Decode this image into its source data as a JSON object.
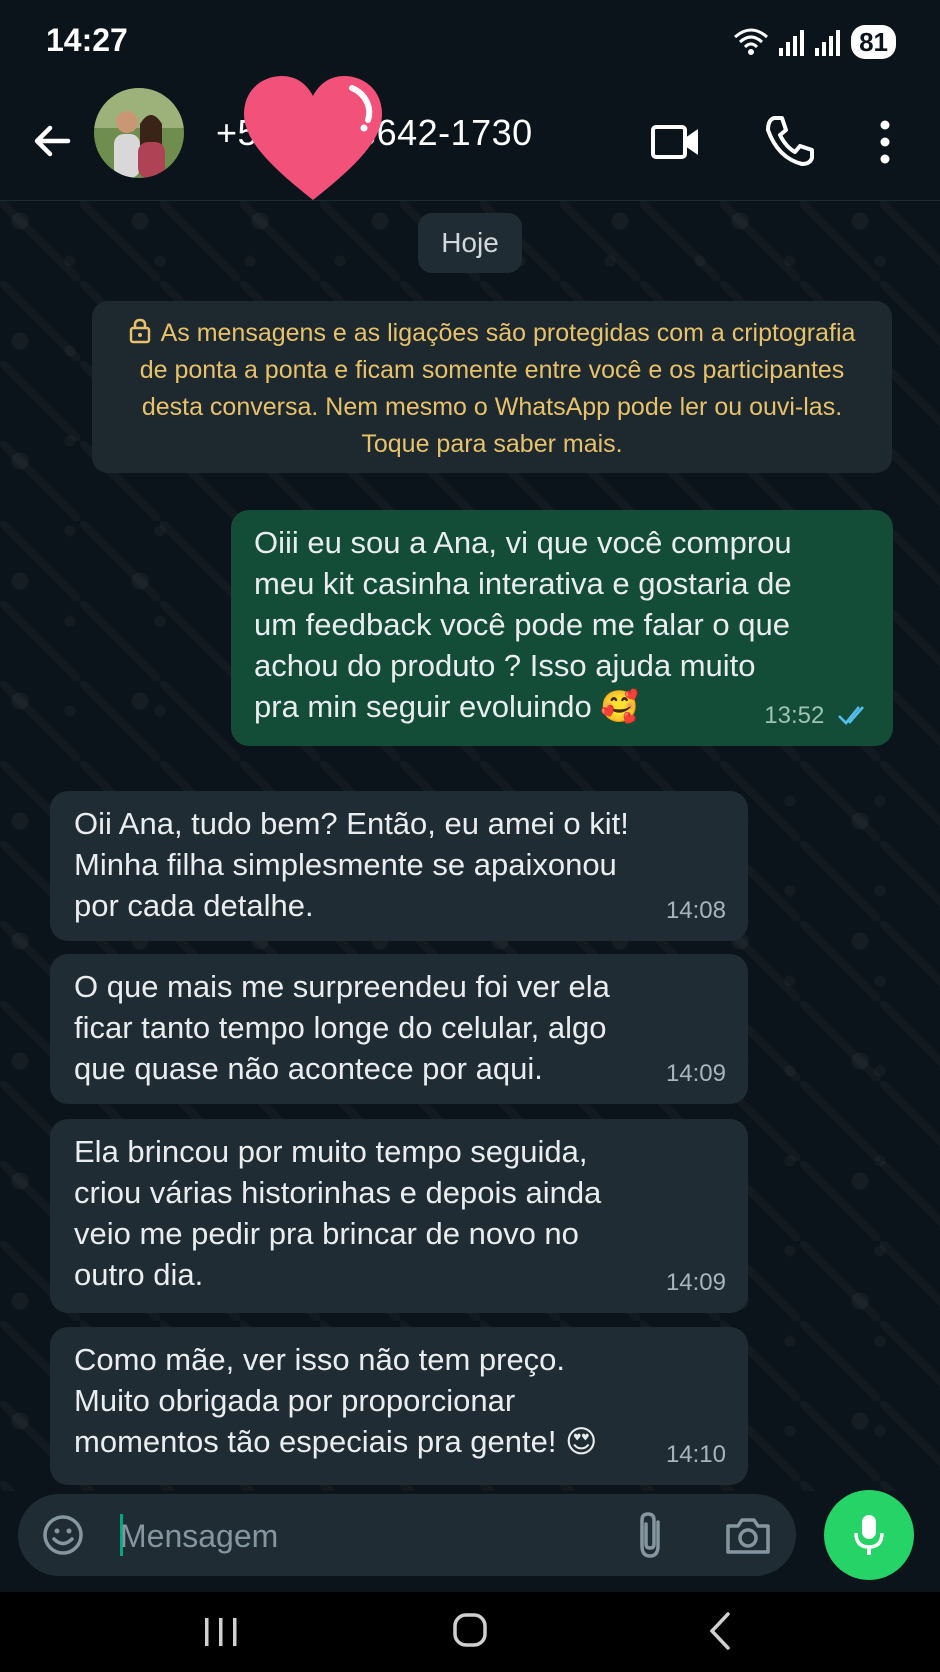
{
  "status_bar": {
    "time": "14:27",
    "battery": "81"
  },
  "header": {
    "contact_visible_start": "+5",
    "contact_visible_end": "3642-1730",
    "back_icon": "arrow-left-icon",
    "video_icon": "video-camera-icon",
    "call_icon": "phone-icon",
    "menu_icon": "more-vert-icon"
  },
  "chat": {
    "day_label": "Hoje",
    "encryption_notice": "As mensagens e as ligações são protegidas com a criptografia de ponta a ponta e ficam somente entre você e os participantes desta conversa. Nem mesmo o WhatsApp pode ler ou ouvi-las. Toque para saber mais.",
    "messages": [
      {
        "direction": "outgoing",
        "text": "Oiii eu sou a Ana, vi que você comprou\nmeu kit casinha interativa e gostaria de\num feedback você pode me falar o que\nachou do produto ? Isso ajuda muito\npra min seguir evoluindo",
        "emoji": "🥰",
        "time": "13:52",
        "status": "read"
      },
      {
        "direction": "incoming",
        "text": "Oii Ana, tudo bem? Então, eu amei o kit!\nMinha filha simplesmente se apaixonou\npor cada detalhe.",
        "time": "14:08"
      },
      {
        "direction": "incoming",
        "text": "O que mais me surpreendeu foi ver ela\nficar tanto tempo longe do celular, algo\nque quase não acontece por aqui.",
        "time": "14:09"
      },
      {
        "direction": "incoming",
        "text": "Ela brincou por muito tempo seguida,\ncriou várias historinhas e depois ainda\nveio me pedir pra brincar de novo no\noutro dia.",
        "time": "14:09"
      },
      {
        "direction": "incoming",
        "text": "Como mãe, ver isso não tem preço.\nMuito obrigada por proporcionar\nmomentos tão especiais pra gente!",
        "emoji": "😍",
        "time": "14:10"
      }
    ]
  },
  "composer": {
    "placeholder": "Mensagem",
    "emoji_icon": "emoji-icon",
    "attach_icon": "paperclip-icon",
    "camera_icon": "camera-icon",
    "mic_icon": "microphone-icon"
  },
  "colors": {
    "background": "#0b141a",
    "outgoing_bubble": "#144d37",
    "incoming_bubble": "#202c33",
    "notice_text": "#e8c26a",
    "accent_green": "#25d366",
    "read_ticks": "#53bdeb"
  }
}
